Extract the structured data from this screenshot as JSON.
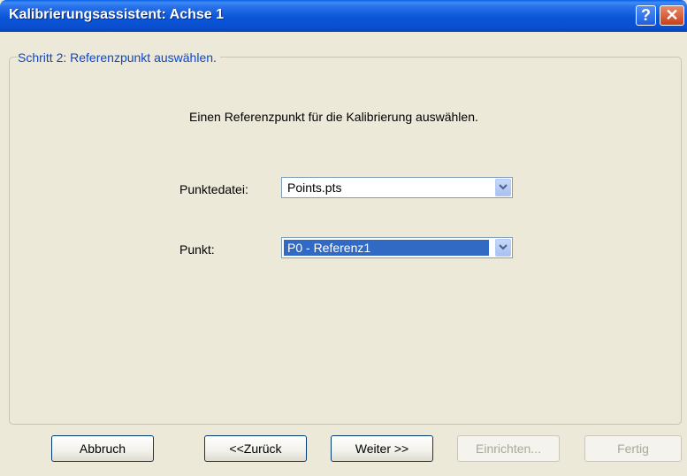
{
  "window": {
    "title": "Kalibrierungsassistent: Achse 1",
    "help_label": "?",
    "close_label": "✕"
  },
  "step": {
    "heading": "Schritt 2: Referenzpunkt auswählen.",
    "instruction": "Einen Referenzpunkt für die Kalibrierung auswählen."
  },
  "fields": {
    "point_file": {
      "label": "Punktedatei:",
      "value": "Points.pts"
    },
    "point": {
      "label": "Punkt:",
      "value": "P0 - Referenz1"
    }
  },
  "buttons": {
    "cancel": {
      "label": "Abbruch",
      "enabled": true
    },
    "back": {
      "label": "<<Zurück",
      "enabled": true
    },
    "next": {
      "label": "Weiter >>",
      "enabled": true
    },
    "setup": {
      "label": "Einrichten...",
      "enabled": false
    },
    "finish": {
      "label": "Fertig",
      "enabled": false
    }
  },
  "icons": {
    "dropdown": "chevron-down-icon",
    "help": "help-icon",
    "close": "close-icon"
  },
  "colors": {
    "titlebar": "#0a4fd0",
    "dialog_bg": "#ece9d8",
    "heading_text": "#1046c8",
    "selection": "#316ac5"
  }
}
